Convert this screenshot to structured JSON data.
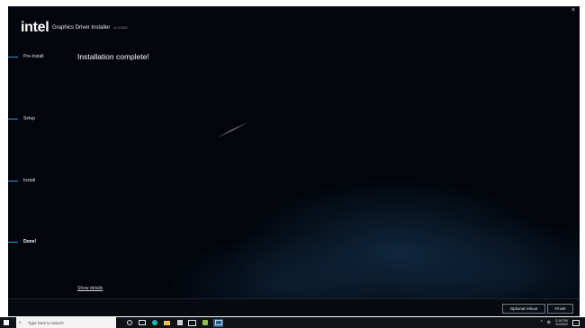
{
  "installer": {
    "brand": "intel",
    "product": "Graphics Driver Installer",
    "version": "v1.0.0152",
    "close_glyph": "×",
    "title": "Installation complete!",
    "steps": [
      {
        "label": "Pre-Install",
        "state": "complete"
      },
      {
        "label": "Setup",
        "state": "complete"
      },
      {
        "label": "Install",
        "state": "complete"
      },
      {
        "label": "Done!",
        "state": "current"
      }
    ],
    "show_details": "Show details",
    "optional_reboot": "Optional reboot",
    "finish": "Finish",
    "accent_color": "#2b97d4",
    "background_color": "#02050b"
  },
  "taskbar": {
    "search_placeholder": "Type here to search",
    "icons": [
      "windows-icon",
      "search-icon",
      "cortana-icon",
      "task-view-icon",
      "edge-icon",
      "file-explorer-icon",
      "store-icon",
      "mail-icon",
      "app-icon",
      "intel-installer-icon"
    ],
    "tray": {
      "chevron": "^",
      "network_glyph": "⊕",
      "time": "2:16 PM",
      "date": "1/1/2022"
    }
  }
}
